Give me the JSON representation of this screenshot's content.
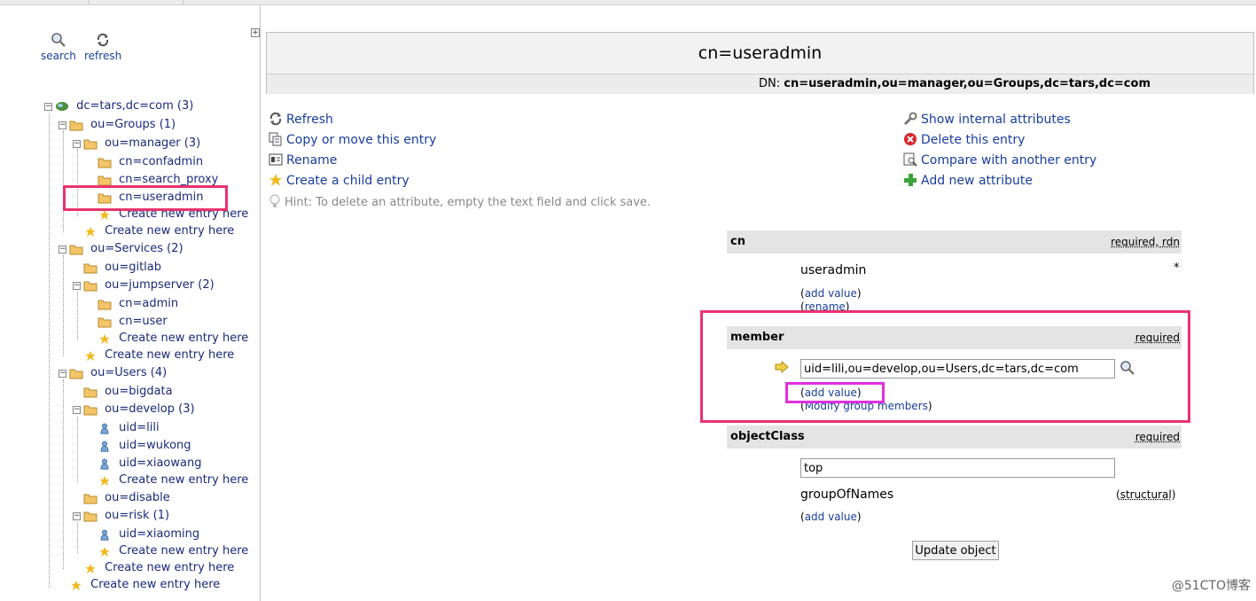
{
  "toolbar": {
    "search_label": "search",
    "refresh_label": "refresh",
    "expand_symbol": "+"
  },
  "tree": {
    "items": [
      {
        "label": "dc=tars,dc=com (3)"
      },
      {
        "label": "ou=Groups (1)"
      },
      {
        "label": "ou=manager (3)"
      },
      {
        "label": "cn=confadmin"
      },
      {
        "label": "cn=search_proxy"
      },
      {
        "label": "cn=useradmin"
      },
      {
        "label": "Create new entry here"
      },
      {
        "label": "Create new entry here"
      },
      {
        "label": "ou=Services (2)"
      },
      {
        "label": "ou=gitlab"
      },
      {
        "label": "ou=jumpserver (2)"
      },
      {
        "label": "cn=admin"
      },
      {
        "label": "cn=user"
      },
      {
        "label": "Create new entry here"
      },
      {
        "label": "Create new entry here"
      },
      {
        "label": "ou=Users (4)"
      },
      {
        "label": "ou=bigdata"
      },
      {
        "label": "ou=develop (3)"
      },
      {
        "label": "uid=lili"
      },
      {
        "label": "uid=wukong"
      },
      {
        "label": "uid=xiaowang"
      },
      {
        "label": "Create new entry here"
      },
      {
        "label": "ou=disable"
      },
      {
        "label": "ou=risk (1)"
      },
      {
        "label": "uid=xiaoming"
      },
      {
        "label": "Create new entry here"
      },
      {
        "label": "Create new entry here"
      },
      {
        "label": "Create new entry here"
      }
    ]
  },
  "entry": {
    "title": "cn=useradmin",
    "dn_label": "DN:",
    "dn_value": "cn=useradmin,ou=manager,ou=Groups,dc=tars,dc=com"
  },
  "actions": {
    "refresh": "Refresh",
    "copy_move": "Copy or move this entry",
    "rename": "Rename",
    "create_child": "Create a child entry",
    "show_internal": "Show internal attributes",
    "delete": "Delete this entry",
    "compare": "Compare with another entry",
    "add_attribute": "Add new attribute",
    "hint": "Hint: To delete an attribute, empty the text field and click save."
  },
  "attributes": {
    "cn": {
      "name": "cn",
      "flag_required": "required",
      "flag_sep": ", ",
      "flag_rdn": "rdn",
      "value": "useradmin",
      "marker": "*",
      "add_value": "add value",
      "rename": "rename"
    },
    "member": {
      "name": "member",
      "flag_required": "required",
      "value": "uid=lili,ou=develop,ou=Users,dc=tars,dc=com",
      "add_value": "add value",
      "modify_members": "Modify group members"
    },
    "objectClass": {
      "name": "objectClass",
      "flag_required": "required",
      "value": "top",
      "value2": "groupOfNames",
      "structural": "structural",
      "add_value": "add value"
    }
  },
  "update_button": "Update object",
  "watermark": "@51CTO博客",
  "colors": {
    "link": "#1a3e9e",
    "highlight_red": "#e8336d",
    "highlight_magenta": "#e030e0",
    "header_bg": "#e4e4e4"
  }
}
